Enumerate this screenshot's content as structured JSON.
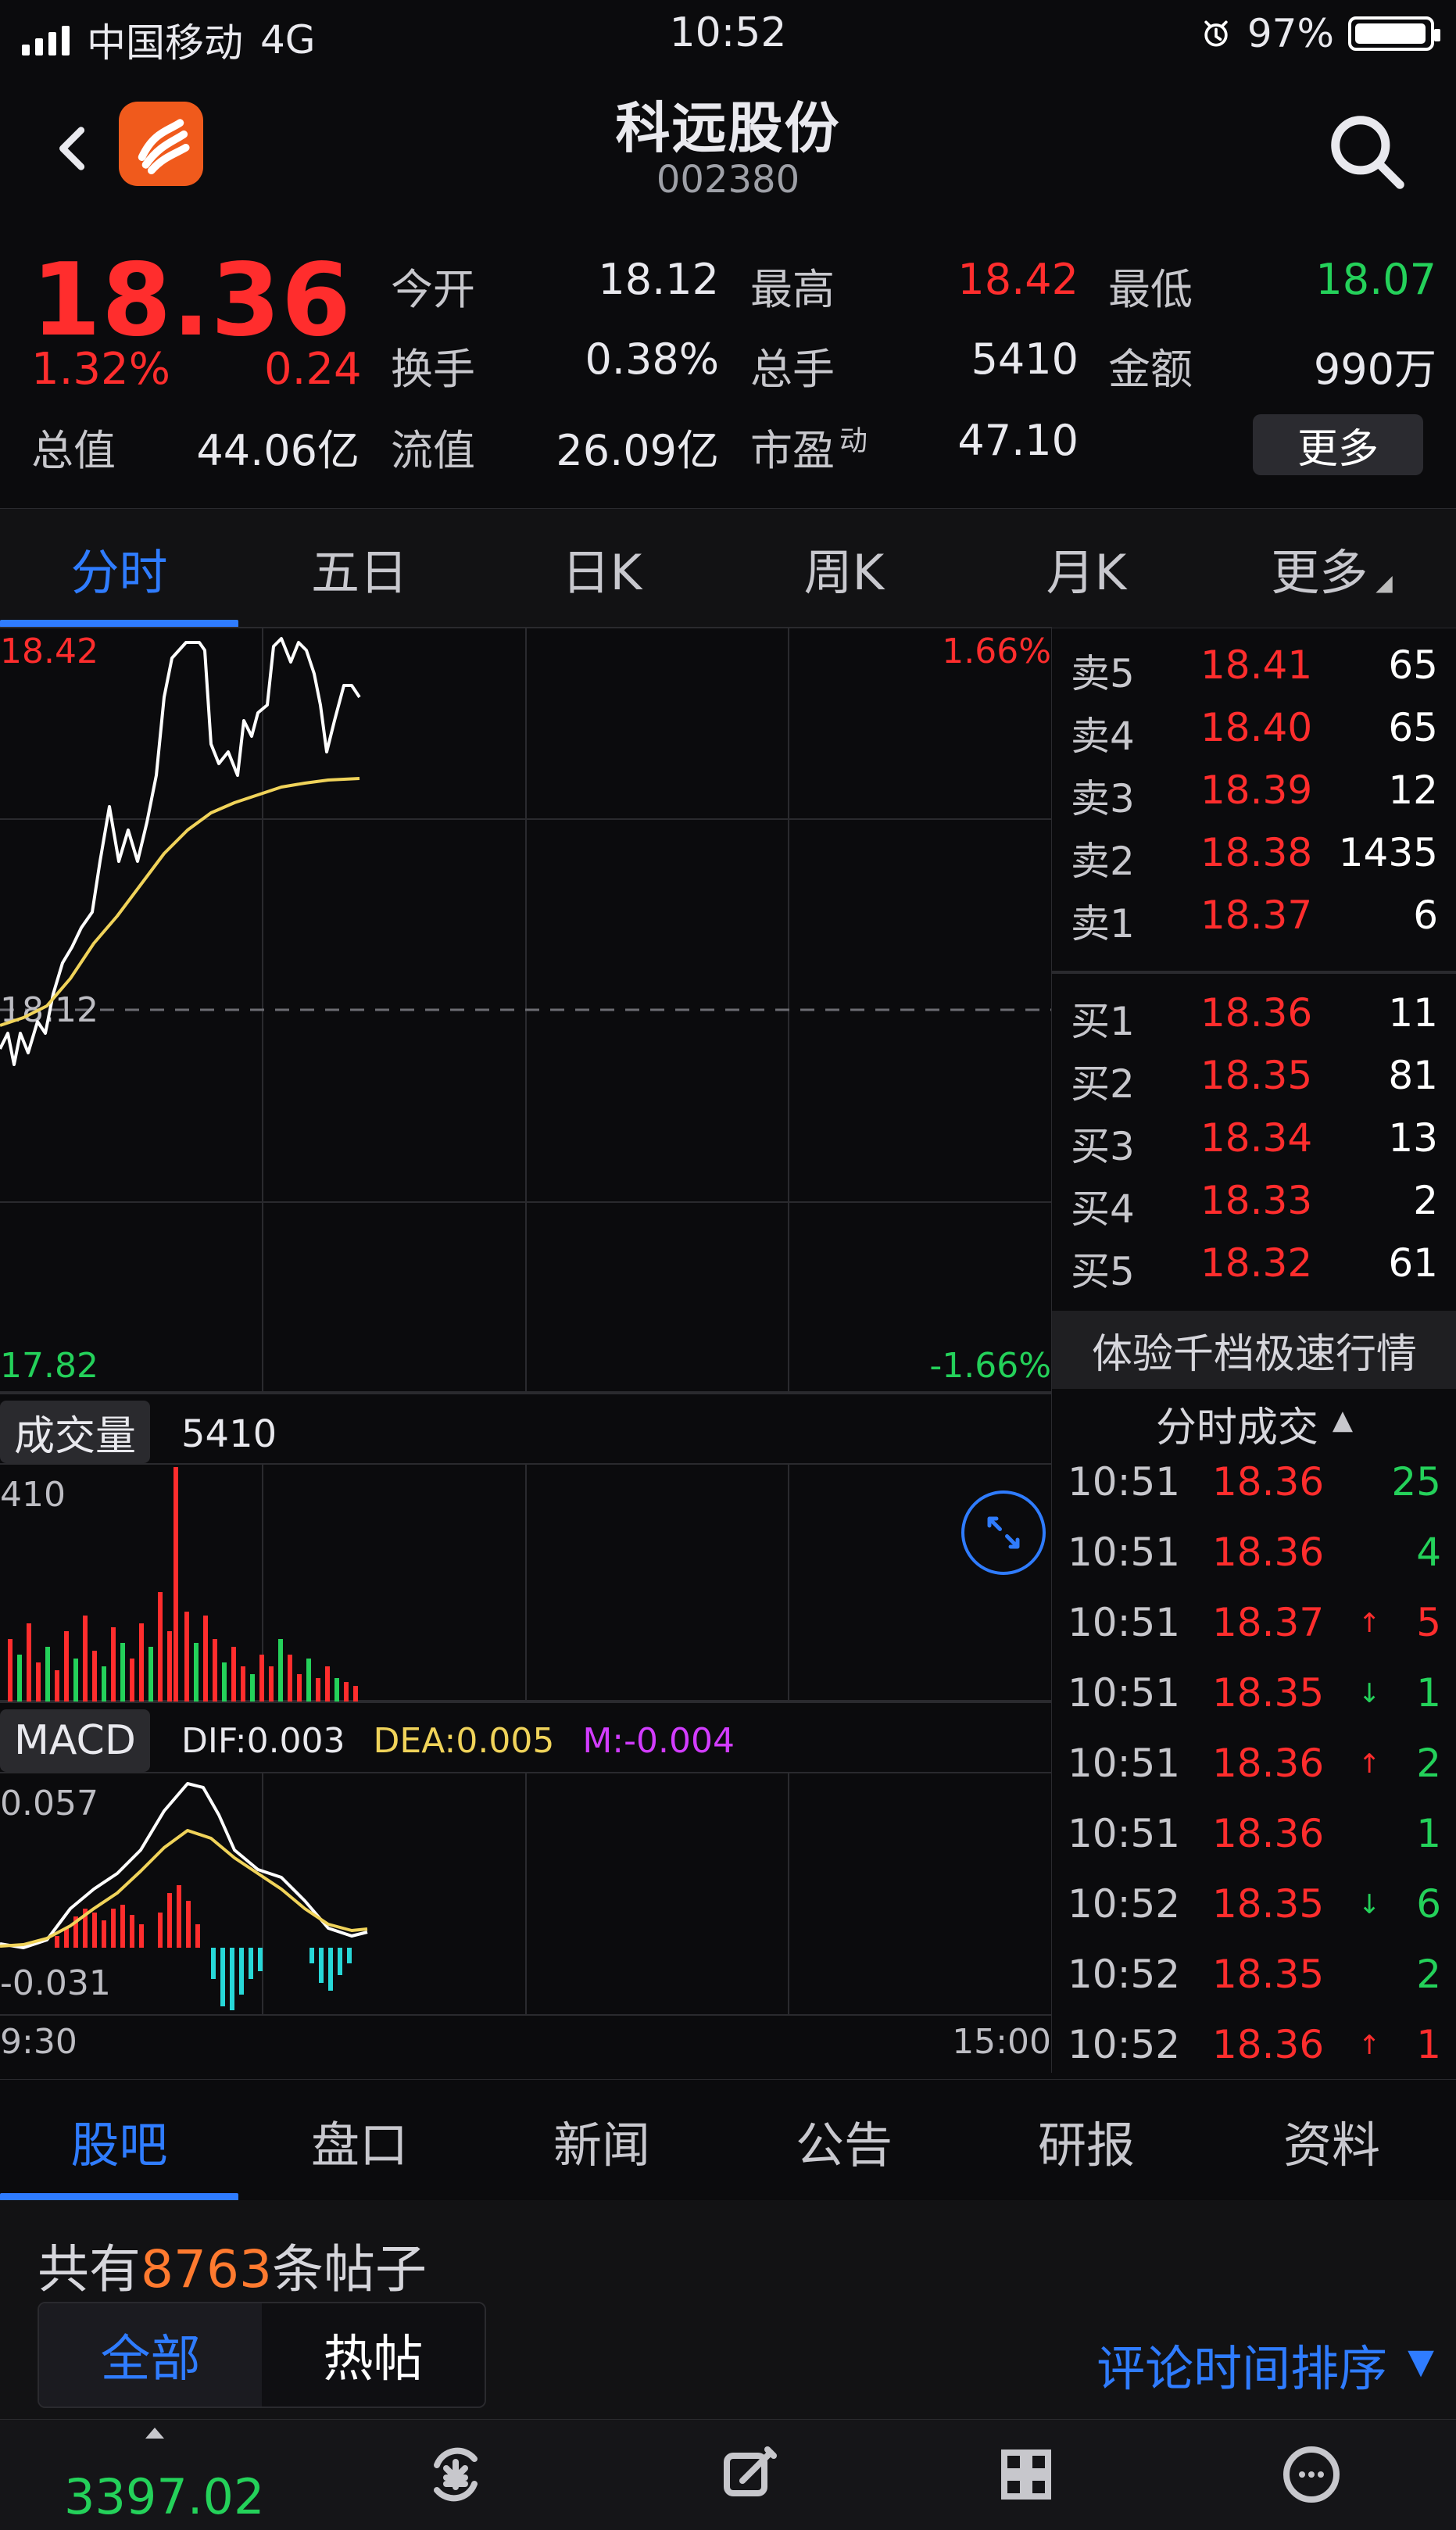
{
  "status_bar": {
    "carrier": "中国移动",
    "network": "4G",
    "time": "10:52",
    "battery": "97%"
  },
  "header": {
    "title": "科远股份",
    "code": "002380"
  },
  "quote": {
    "last": "18.36",
    "chg_pct": "1.32%",
    "chg": "0.24",
    "open_label": "今开",
    "open": "18.12",
    "high_label": "最高",
    "high": "18.42",
    "low_label": "最低",
    "low": "18.07",
    "turnover_label": "换手",
    "turnover": "0.38%",
    "total_volume_label": "总手",
    "total_volume": "5410",
    "amount_label": "金额",
    "amount": "990万",
    "mktcap_label": "总值",
    "mktcap": "44.06亿",
    "float_label": "流值",
    "float": "26.09亿",
    "pe_label": "市盈",
    "pe_sup": "动",
    "pe": "47.10",
    "more_btn": "更多"
  },
  "top_tabs": [
    {
      "label": "分时",
      "active": true
    },
    {
      "label": "五日",
      "active": false
    },
    {
      "label": "日K",
      "active": false
    },
    {
      "label": "周K",
      "active": false
    },
    {
      "label": "月K",
      "active": false
    },
    {
      "label": "更多",
      "active": false
    }
  ],
  "intraday": {
    "top_price": "18.42",
    "mid_price": "18.12",
    "bottom_price": "17.82",
    "top_pct": "1.66%",
    "bottom_pct": "-1.66%",
    "start_time": "9:30",
    "end_time": "15:00",
    "volume_label": "成交量",
    "volume_value": "5410",
    "volume_max": "410",
    "macd_label": "MACD",
    "dif": "DIF:0.003",
    "dea": "DEA:0.005",
    "m": "M:-0.004",
    "macd_top": "0.057",
    "macd_bottom": "-0.031"
  },
  "order_book": {
    "asks": [
      {
        "side": "卖5",
        "price": "18.41",
        "qty": "65"
      },
      {
        "side": "卖4",
        "price": "18.40",
        "qty": "65"
      },
      {
        "side": "卖3",
        "price": "18.39",
        "qty": "12"
      },
      {
        "side": "卖2",
        "price": "18.38",
        "qty": "1435"
      },
      {
        "side": "卖1",
        "price": "18.37",
        "qty": "6"
      }
    ],
    "bids": [
      {
        "side": "买1",
        "price": "18.36",
        "qty": "11"
      },
      {
        "side": "买2",
        "price": "18.35",
        "qty": "81"
      },
      {
        "side": "买3",
        "price": "18.34",
        "qty": "13"
      },
      {
        "side": "买4",
        "price": "18.33",
        "qty": "2"
      },
      {
        "side": "买5",
        "price": "18.32",
        "qty": "61"
      }
    ],
    "banner": "体验千档极速行情",
    "trades_title": "分时成交",
    "trades": [
      {
        "time": "10:51",
        "price": "18.36",
        "arrow": "",
        "vol": "25",
        "vol_color": "#24d15a"
      },
      {
        "time": "10:51",
        "price": "18.36",
        "arrow": "",
        "vol": "4",
        "vol_color": "#24d15a"
      },
      {
        "time": "10:51",
        "price": "18.37",
        "arrow": "↑",
        "vol": "5",
        "vol_color": "#ff2d2d"
      },
      {
        "time": "10:51",
        "price": "18.35",
        "arrow": "↓",
        "vol": "1",
        "vol_color": "#24d15a"
      },
      {
        "time": "10:51",
        "price": "18.36",
        "arrow": "↑",
        "vol": "2",
        "vol_color": "#24d15a"
      },
      {
        "time": "10:51",
        "price": "18.36",
        "arrow": "",
        "vol": "1",
        "vol_color": "#24d15a"
      },
      {
        "time": "10:52",
        "price": "18.35",
        "arrow": "↓",
        "vol": "6",
        "vol_color": "#24d15a"
      },
      {
        "time": "10:52",
        "price": "18.35",
        "arrow": "",
        "vol": "2",
        "vol_color": "#24d15a"
      },
      {
        "time": "10:52",
        "price": "18.36",
        "arrow": "↑",
        "vol": "1",
        "vol_color": "#ff2d2d"
      }
    ]
  },
  "bottom_tabs": [
    {
      "label": "股吧",
      "active": true
    },
    {
      "label": "盘口",
      "active": false
    },
    {
      "label": "新闻",
      "active": false
    },
    {
      "label": "公告",
      "active": false
    },
    {
      "label": "研报",
      "active": false
    },
    {
      "label": "资料",
      "active": false
    }
  ],
  "posts": {
    "prefix": "共有",
    "count": "8763",
    "suffix": "条帖子",
    "filter_all": "全部",
    "filter_hot": "热帖",
    "sort_label": "评论时间排序"
  },
  "dock": {
    "index_value": "3397.02"
  },
  "icons": {
    "back": "chevron-left-icon",
    "app": "app-logo-icon",
    "search": "search-icon",
    "alarm": "alarm-icon",
    "expand": "expand-icon"
  },
  "colors": {
    "up": "#ff2d2d",
    "down": "#24d15a",
    "accent": "#2f7cff",
    "avg_line": "#f0d35a",
    "dea": "#f0d35a",
    "m": "#d23cff",
    "macd_neg": "#27d8d8"
  }
}
